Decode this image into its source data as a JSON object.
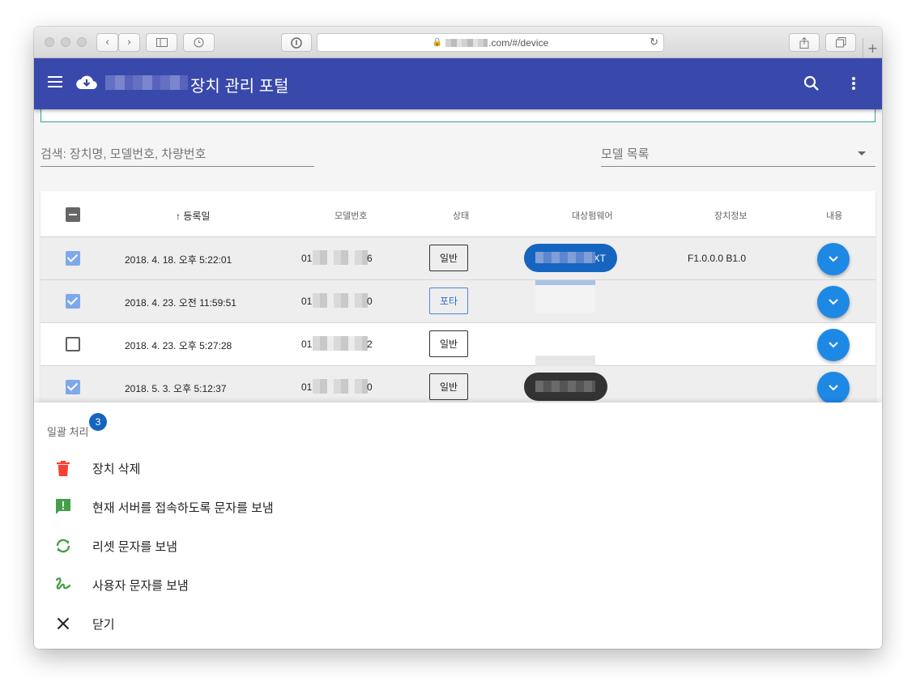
{
  "browser": {
    "url_suffix": ".com/#/device",
    "new_tab": "+"
  },
  "appbar": {
    "title": "장치 관리 포털"
  },
  "filters": {
    "search_placeholder": "검색: 장치명, 모델번호, 차량번호",
    "model_placeholder": "모델 목록"
  },
  "table": {
    "headers": {
      "registered": "↑ 등록일",
      "model": "모델번호",
      "status": "상태",
      "firmware": "대상펌웨어",
      "device_info": "장치정보",
      "content": "내용"
    },
    "rows": [
      {
        "selected": true,
        "date": "2018. 4. 18. 오후 5:22:01",
        "model_prefix": "01",
        "model_suffix": "6",
        "status": "일반",
        "firmware_suffix": "XT",
        "device_info": "F1.0.0.0 B1.0"
      },
      {
        "selected": true,
        "date": "2018. 4. 23. 오전 11:59:51",
        "model_prefix": "01",
        "model_suffix": "0",
        "status": "포타",
        "firmware_suffix": "",
        "device_info": ""
      },
      {
        "selected": false,
        "date": "2018. 4. 23. 오후 5:27:28",
        "model_prefix": "01",
        "model_suffix": "2",
        "status": "일반",
        "firmware_suffix": "",
        "device_info": ""
      },
      {
        "selected": true,
        "date": "2018. 5. 3. 오후 5:12:37",
        "model_prefix": "01",
        "model_suffix": "0",
        "status": "일반",
        "firmware_suffix": "",
        "device_info": ""
      }
    ]
  },
  "batch_sheet": {
    "title": "일괄 처리",
    "count": "3",
    "actions": {
      "delete": "장치 삭제",
      "sms_connect": "현재 서버를 접속하도록 문자를 보냄",
      "sms_reset": "리셋 문자를 보냄",
      "sms_user": "사용자 문자를 보냄",
      "close": "닫기"
    }
  },
  "colors": {
    "appbar": "#3949ab",
    "delete_icon": "#f44336",
    "sms_icon": "#43a047",
    "expand_button": "#1e88e5"
  }
}
